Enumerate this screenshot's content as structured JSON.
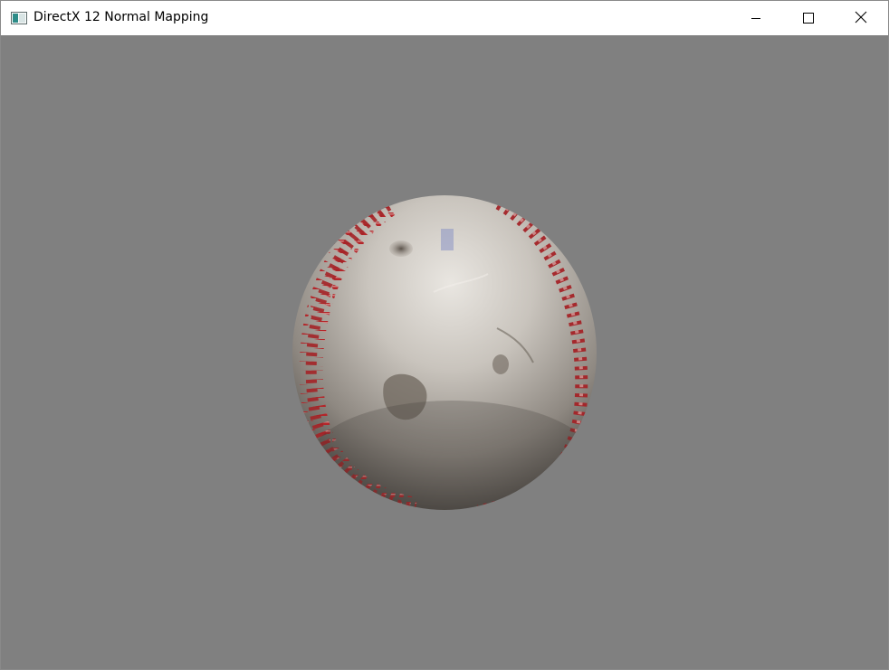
{
  "window": {
    "title": "DirectX 12 Normal Mapping",
    "app_icon": "window-app-icon",
    "controls": {
      "minimize_icon": "minimize-icon",
      "maximize_icon": "maximize-icon",
      "close_icon": "close-icon"
    }
  },
  "viewport": {
    "background_color": "#808080",
    "scene_object": "baseball-model"
  }
}
